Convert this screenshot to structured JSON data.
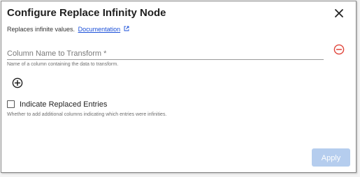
{
  "dialog": {
    "title": "Configure Replace Infinity Node",
    "subtitle": "Replaces infinite values.",
    "doc_link": "Documentation"
  },
  "column_field": {
    "placeholder": "Column Name to Transform *",
    "value": "",
    "helper": "Name of a column containing the data to transform."
  },
  "indicate": {
    "label": "Indicate Replaced Entries",
    "checked": false,
    "helper": "Whether to add additional columns indicating which entries were infinities."
  },
  "footer": {
    "apply_label": "Apply"
  },
  "icons": {
    "close": "close-icon",
    "external_link": "external-link-icon",
    "remove": "remove-circle-icon",
    "add": "add-circle-icon"
  },
  "colors": {
    "link": "#1a4fd8",
    "remove": "#e0443a",
    "apply_disabled": "#b5cdee"
  }
}
